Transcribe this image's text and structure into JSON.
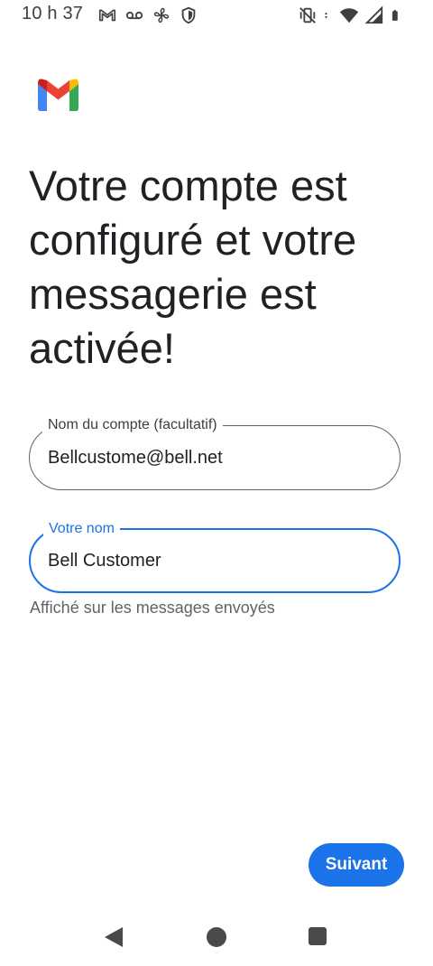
{
  "status_bar": {
    "time": "10 h 37",
    "left_icons": [
      "gmail-icon",
      "voicemail-icon",
      "fan-icon",
      "shield-icon"
    ],
    "right_icons": [
      "vibrate-off-icon",
      "data-arrows-icon",
      "wifi-icon",
      "signal-icon",
      "battery-icon"
    ]
  },
  "logo": {
    "name": "gmail-logo"
  },
  "page": {
    "title": "Votre compte est configuré et votre messagerie est activée!"
  },
  "form": {
    "account_name": {
      "label": "Nom du compte (facultatif)",
      "value": "Bellcustome@bell.net"
    },
    "your_name": {
      "label": "Votre nom",
      "value": "Bell Customer",
      "helper": "Affiché sur les messages envoyés"
    }
  },
  "actions": {
    "next_label": "Suivant"
  },
  "nav_bar": {
    "buttons": [
      "back-icon",
      "home-icon",
      "recents-icon"
    ]
  },
  "colors": {
    "accent": "#1a73e8",
    "text": "#202124",
    "secondary_text": "#5f6368"
  }
}
